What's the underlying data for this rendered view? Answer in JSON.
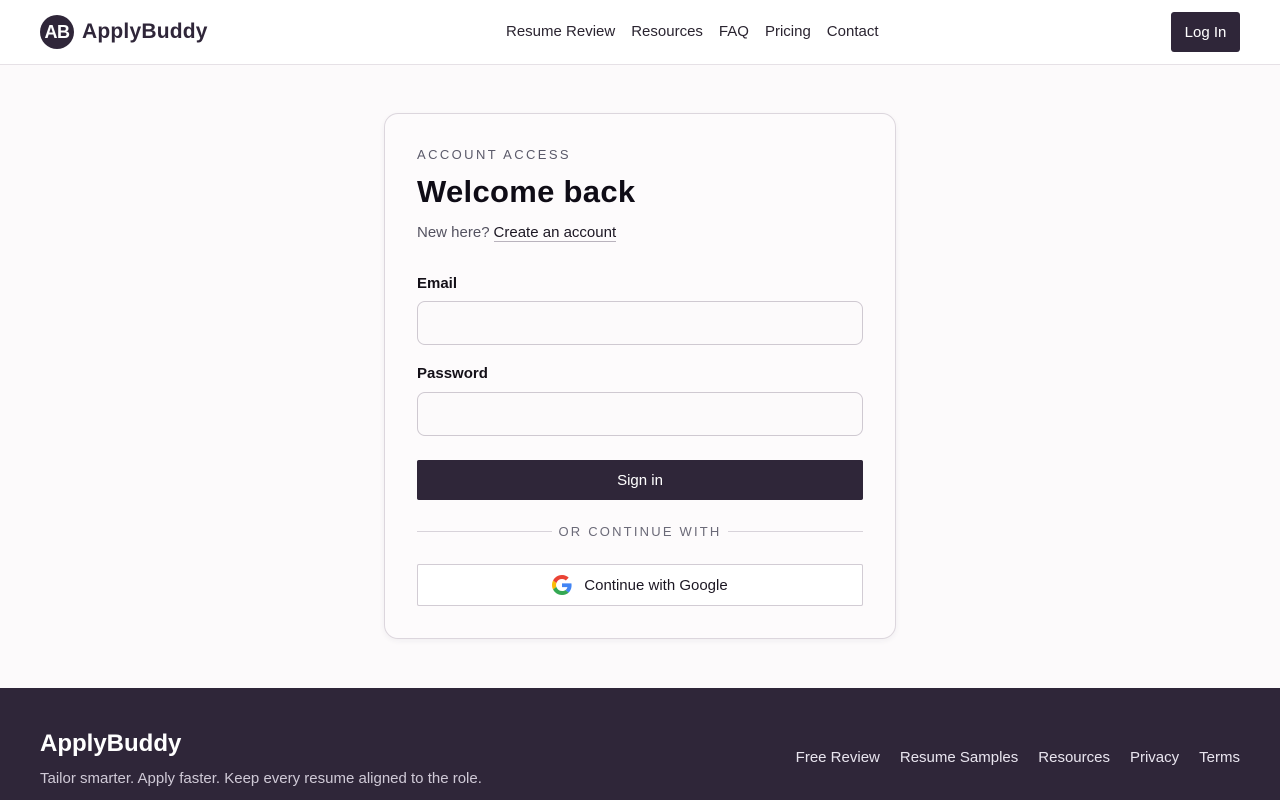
{
  "header": {
    "logo_badge": "AB",
    "brand_name": "ApplyBuddy",
    "nav": [
      {
        "label": "Resume Review"
      },
      {
        "label": "Resources"
      },
      {
        "label": "FAQ"
      },
      {
        "label": "Pricing"
      },
      {
        "label": "Contact"
      }
    ],
    "login_label": "Log In"
  },
  "card": {
    "eyebrow": "ACCOUNT ACCESS",
    "title": "Welcome back",
    "new_here": "New here?",
    "create_account_link": "Create an account",
    "email_label": "Email",
    "email_value": "",
    "password_label": "Password",
    "password_value": "",
    "signin_label": "Sign in",
    "divider_text": "OR CONTINUE WITH",
    "google_label": "Continue with Google"
  },
  "footer": {
    "brand_name": "ApplyBuddy",
    "tagline": "Tailor smarter. Apply faster. Keep every resume aligned to the role.",
    "links": [
      {
        "label": "Free Review"
      },
      {
        "label": "Resume Samples"
      },
      {
        "label": "Resources"
      },
      {
        "label": "Privacy"
      },
      {
        "label": "Terms"
      }
    ]
  },
  "colors": {
    "brand_dark": "#2f2639",
    "page_bg": "#fcfafb",
    "card_border": "#dcd6dd"
  },
  "icons": {
    "logo": "ab-monogram-badge",
    "google": "google-g-icon"
  }
}
